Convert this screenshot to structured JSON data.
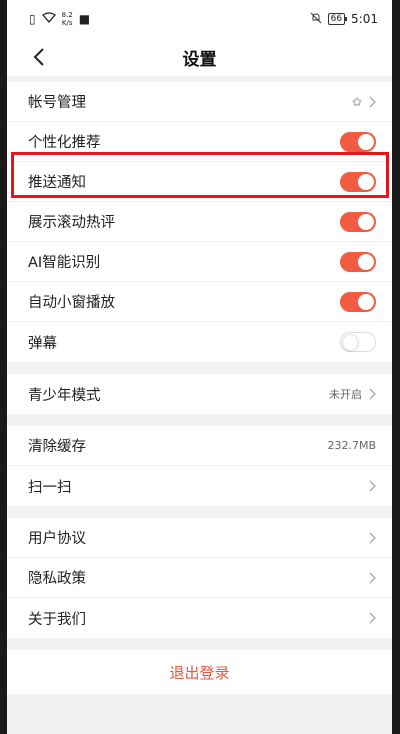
{
  "status_bar": {
    "speed_value": "8.2",
    "speed_unit": "K/s",
    "battery": "66",
    "time": "5:01"
  },
  "nav": {
    "title": "设置"
  },
  "group1": {
    "account": {
      "label": "帐号管理"
    },
    "personalized": {
      "label": "个性化推荐",
      "toggle": "on"
    },
    "push": {
      "label": "推送通知",
      "toggle": "on"
    },
    "hot_comments": {
      "label": "展示滚动热评",
      "toggle": "on"
    },
    "ai": {
      "label": "AI智能识别",
      "toggle": "on"
    },
    "mini_window": {
      "label": "自动小窗播放",
      "toggle": "on"
    },
    "danmaku": {
      "label": "弹幕",
      "toggle": "off"
    }
  },
  "group2": {
    "youth": {
      "label": "青少年模式",
      "value": "未开启"
    }
  },
  "group3": {
    "cache": {
      "label": "清除缓存",
      "value": "232.7MB"
    },
    "scan": {
      "label": "扫一扫"
    }
  },
  "group4": {
    "agreement": {
      "label": "用户协议"
    },
    "privacy": {
      "label": "隐私政策"
    },
    "about": {
      "label": "关于我们"
    }
  },
  "logout_label": "退出登录",
  "colors": {
    "accent": "#f05b41",
    "highlight": "#e8141c",
    "logout": "#e8563d"
  }
}
